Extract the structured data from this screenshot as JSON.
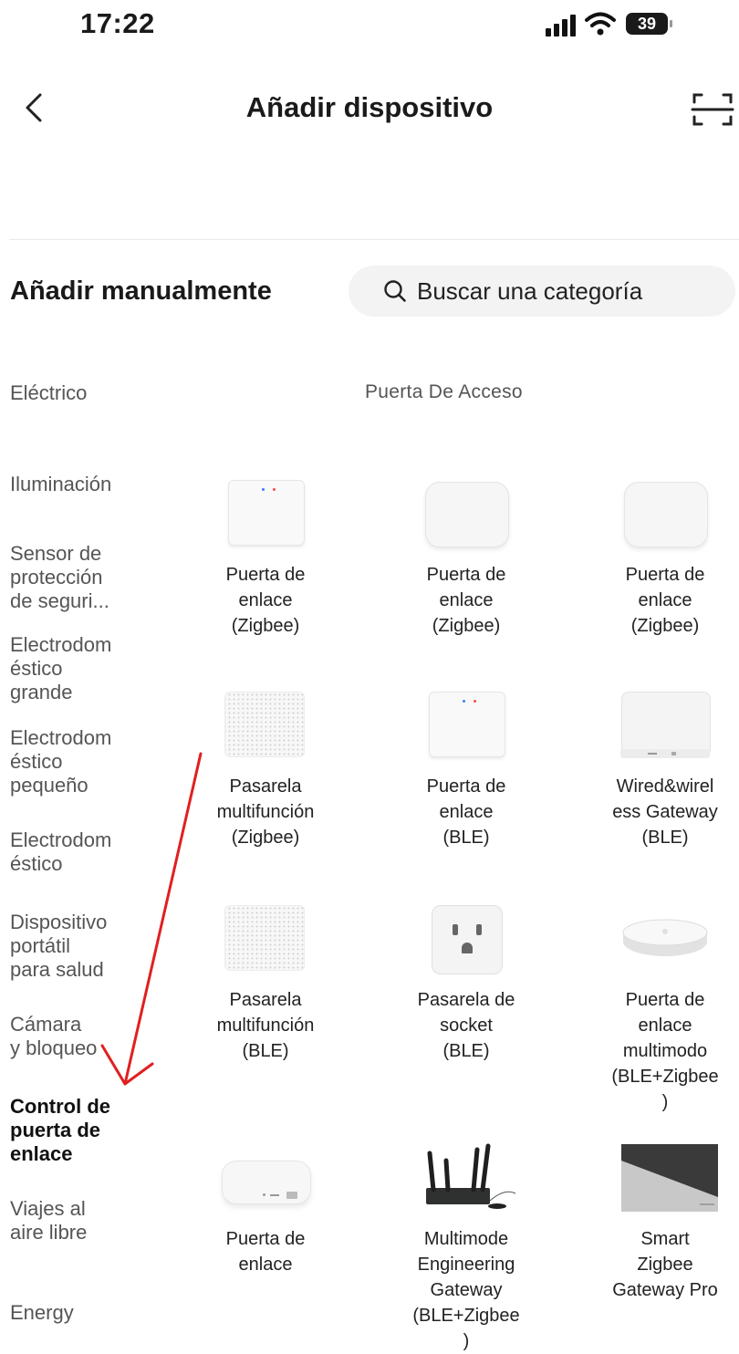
{
  "status_bar": {
    "time": "17:22",
    "battery": "39"
  },
  "header": {
    "title": "Añadir dispositivo"
  },
  "manual": {
    "title": "Añadir manualmente",
    "search_placeholder": "Buscar una categoría"
  },
  "categories": [
    "Eléctrico",
    "Iluminación",
    "Sensor de\nprotección\nde seguri...",
    "Electrodom\néstico\ngrande",
    "Electrodom\néstico\npequeño",
    "Electrodom\néstico",
    "Dispositivo\nportátil\npara salud",
    "Cámara\ny bloqueo",
    "Control de\npuerta de\nenlace",
    "Viajes al\naire libre",
    "Energy"
  ],
  "active_category": "Control de puerta de enlace",
  "section": {
    "title": "Puerta De Acceso"
  },
  "devices": [
    {
      "label": "Puerta de\nenlace\n(Zigbee)",
      "icon": "gateway-box-icon"
    },
    {
      "label": "Puerta de\nenlace\n(Zigbee)",
      "icon": "gateway-rounded-icon"
    },
    {
      "label": "Puerta de\nenlace\n(Zigbee)",
      "icon": "gateway-rounded-icon"
    },
    {
      "label": "Pasarela\nmultifunción\n(Zigbee)",
      "icon": "speaker-gateway-icon"
    },
    {
      "label": "Puerta de\nenlace\n(BLE)",
      "icon": "gateway-box-icon"
    },
    {
      "label": "Wired&wirel\ness Gateway\n(BLE)",
      "icon": "wired-hub-icon"
    },
    {
      "label": "Pasarela\nmultifunción\n(BLE)",
      "icon": "speaker-gateway-icon"
    },
    {
      "label": "Pasarela de\nsocket\n(BLE)",
      "icon": "socket-icon"
    },
    {
      "label": "Puerta de\nenlace\nmultimodo\n(BLE+Zigbee\n)",
      "icon": "puck-gateway-icon"
    },
    {
      "label": "Puerta de\nenlace",
      "icon": "flat-gateway-icon"
    },
    {
      "label": "Multimode\nEngineering\nGateway\n(BLE+Zigbee\n)",
      "icon": "router-antenna-icon"
    },
    {
      "label": "Smart\nZigbee\nGateway Pro",
      "icon": "gateway-pro-icon"
    }
  ],
  "colors": {
    "annotation_arrow": "#e02020",
    "search_bg": "#f3f3f3",
    "led_blue": "#3a7bff",
    "led_red": "#ff4a4a"
  }
}
